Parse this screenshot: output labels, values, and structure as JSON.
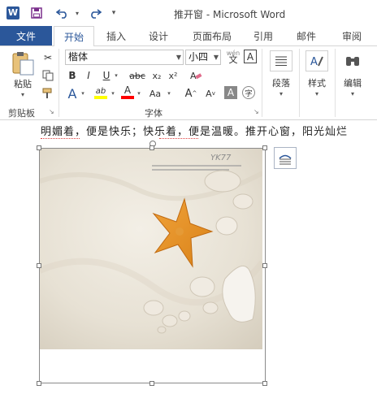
{
  "titlebar": {
    "app_icon": "W",
    "save_icon": "save-icon",
    "undo_icon": "undo-icon",
    "redo_icon": "redo-icon",
    "title": "推开窗 - Microsoft Word"
  },
  "tabs": {
    "file": "文件",
    "items": [
      "开始",
      "插入",
      "设计",
      "页面布局",
      "引用",
      "邮件",
      "审阅"
    ],
    "active": "开始"
  },
  "ribbon": {
    "clipboard": {
      "paste_label": "粘贴",
      "group_label": "剪贴板"
    },
    "font": {
      "name": "楷体",
      "size": "小四",
      "size_up": "A",
      "size_down": "A",
      "clear_format": "A",
      "bold": "B",
      "italic": "I",
      "underline": "U",
      "strike": "abc",
      "subscript": "x₂",
      "superscript": "x²",
      "group_label": "字体",
      "phonetic": "wén",
      "char_border": "A",
      "text_effects": "A",
      "highlight": "ab",
      "font_color": "A",
      "case": "Aa",
      "grow": "A",
      "shrink": "A",
      "shading": "A",
      "enclosed": "字"
    },
    "paragraph": {
      "label": "段落"
    },
    "styles": {
      "label": "样式"
    },
    "editing": {
      "label": "编辑"
    }
  },
  "document": {
    "text_line": "明媚着，便是快乐；快乐着，便是温暖。推开心窗，阳光灿烂",
    "image_watermark": "YK77",
    "image_alt": "starfish-and-seashells-on-sand"
  },
  "colors": {
    "accent": "#2b579a",
    "highlight": "#ffff00",
    "font_red": "#ff0000"
  }
}
